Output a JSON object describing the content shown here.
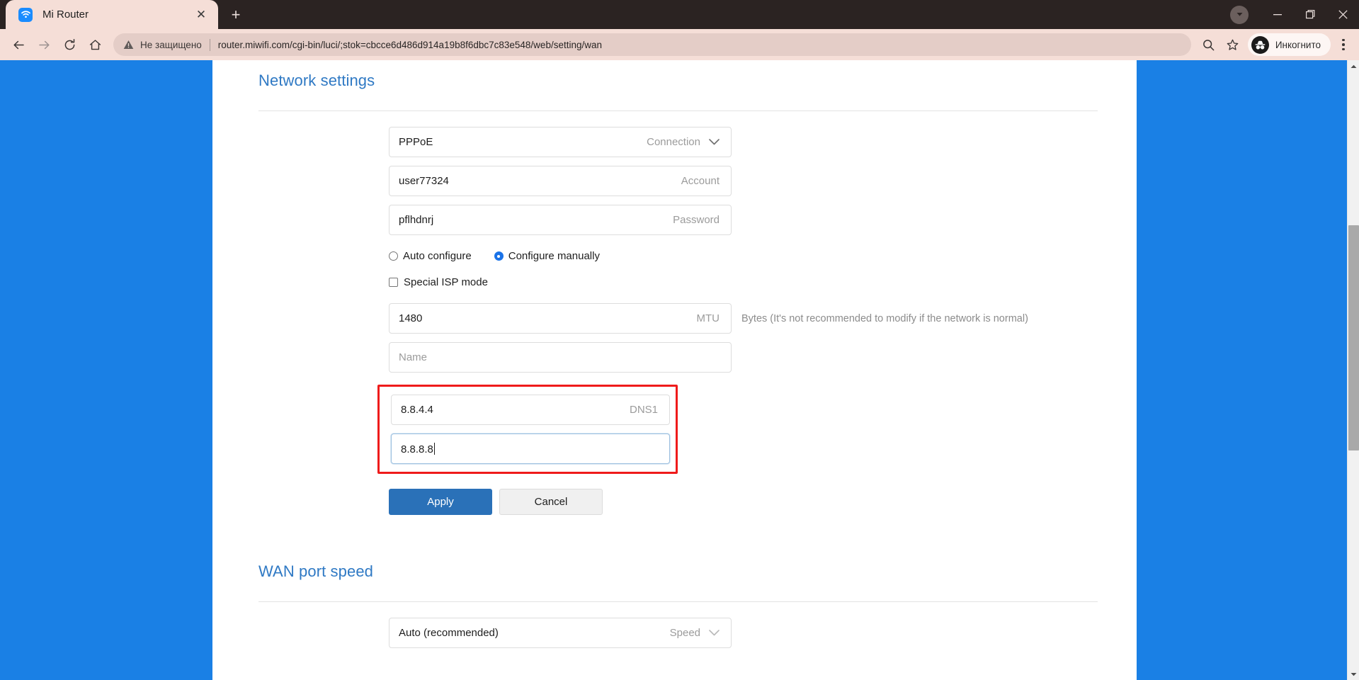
{
  "browser": {
    "tab": {
      "title": "Mi Router",
      "favicon": "wifi-icon",
      "close": "✕"
    },
    "new_tab_label": "+",
    "window_controls": {
      "downloads": "▾",
      "minimize": "—",
      "maximize": "❐",
      "close": "✕"
    },
    "nav": {
      "back": "←",
      "forward": "→",
      "reload": "⟳",
      "home": "⌂"
    },
    "omnibox": {
      "security_text": "Не защищено",
      "security_icon": "warning-triangle-icon",
      "url": "router.miwifi.com/cgi-bin/luci/;stok=cbcce6d486d914a19b8f6dbc7c83e548/web/setting/wan",
      "search_icon": "search-icon",
      "bookmark_icon": "star-icon"
    },
    "profile": {
      "label": "Инкогнито",
      "icon": "incognito-icon"
    },
    "menu_icon": "kebab-menu-icon"
  },
  "page": {
    "network_settings": {
      "title": "Network settings",
      "connection": {
        "value": "PPPoE",
        "label": "Connection",
        "chevron": "chevron-down-icon"
      },
      "account": {
        "value": "user77324",
        "label": "Account"
      },
      "password": {
        "value": "pflhdnrj",
        "label": "Password"
      },
      "config_mode": {
        "auto": "Auto configure",
        "manual": "Configure manually",
        "selected": "manual"
      },
      "special_isp": {
        "label": "Special ISP mode",
        "checked": false
      },
      "mtu": {
        "value": "1480",
        "label": "MTU",
        "hint": "Bytes (It's not recommended to modify if the network is normal)"
      },
      "service_name": {
        "value": "",
        "placeholder": "Name"
      },
      "dns1": {
        "value": "8.8.4.4",
        "label": "DNS1"
      },
      "dns2": {
        "value": "8.8.8.8",
        "label": "",
        "focused": true
      },
      "apply_button": "Apply",
      "cancel_button": "Cancel",
      "highlight_color": "#ef1b1b"
    },
    "wan_port_speed": {
      "title": "WAN port speed",
      "speed": {
        "value": "Auto (recommended)",
        "label": "Speed",
        "chevron": "chevron-down-icon"
      }
    },
    "accent_color": "#2f79c4",
    "background_color": "#1a80e5"
  },
  "scrollbar": {
    "up_arrow": "▲",
    "down_arrow": "▼"
  }
}
